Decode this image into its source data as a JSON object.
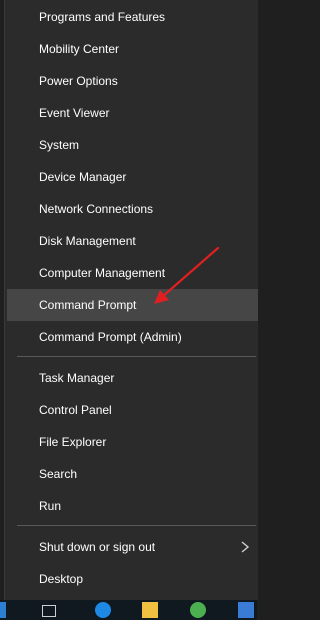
{
  "menu": {
    "items": [
      {
        "label": "Programs and Features"
      },
      {
        "label": "Mobility Center"
      },
      {
        "label": "Power Options"
      },
      {
        "label": "Event Viewer"
      },
      {
        "label": "System"
      },
      {
        "label": "Device Manager"
      },
      {
        "label": "Network Connections"
      },
      {
        "label": "Disk Management"
      },
      {
        "label": "Computer Management"
      },
      {
        "label": "Command Prompt"
      },
      {
        "label": "Command Prompt (Admin)"
      },
      {
        "label": "Task Manager"
      },
      {
        "label": "Control Panel"
      },
      {
        "label": "File Explorer"
      },
      {
        "label": "Search"
      },
      {
        "label": "Run"
      },
      {
        "label": "Shut down or sign out"
      },
      {
        "label": "Desktop"
      }
    ],
    "highlighted_item": "Command Prompt"
  },
  "colors": {
    "menu_bg": "#2b2b2b",
    "hover_bg": "#464646",
    "text": "#ffffff",
    "annotation_arrow": "#e02020"
  },
  "icons": [
    "chevron-right-icon",
    "red-arrow-annotation"
  ]
}
